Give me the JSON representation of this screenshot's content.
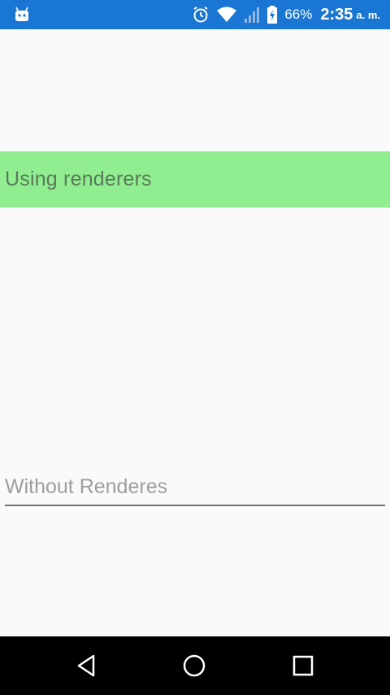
{
  "status_bar": {
    "left_icon": "android-icon",
    "icons": [
      "alarm-icon",
      "wifi-icon",
      "signal-icon",
      "battery-charging-icon"
    ],
    "battery_percent": "66%",
    "time": "2:35",
    "time_suffix": "a. m.",
    "background": "#1976d2"
  },
  "content": {
    "renderer_label": "Using renderers",
    "renderer_background": "#90ee90",
    "plain_entry_value": "Without Renderes"
  },
  "nav_bar": {
    "buttons": [
      "back-icon",
      "home-icon",
      "recents-icon"
    ]
  }
}
